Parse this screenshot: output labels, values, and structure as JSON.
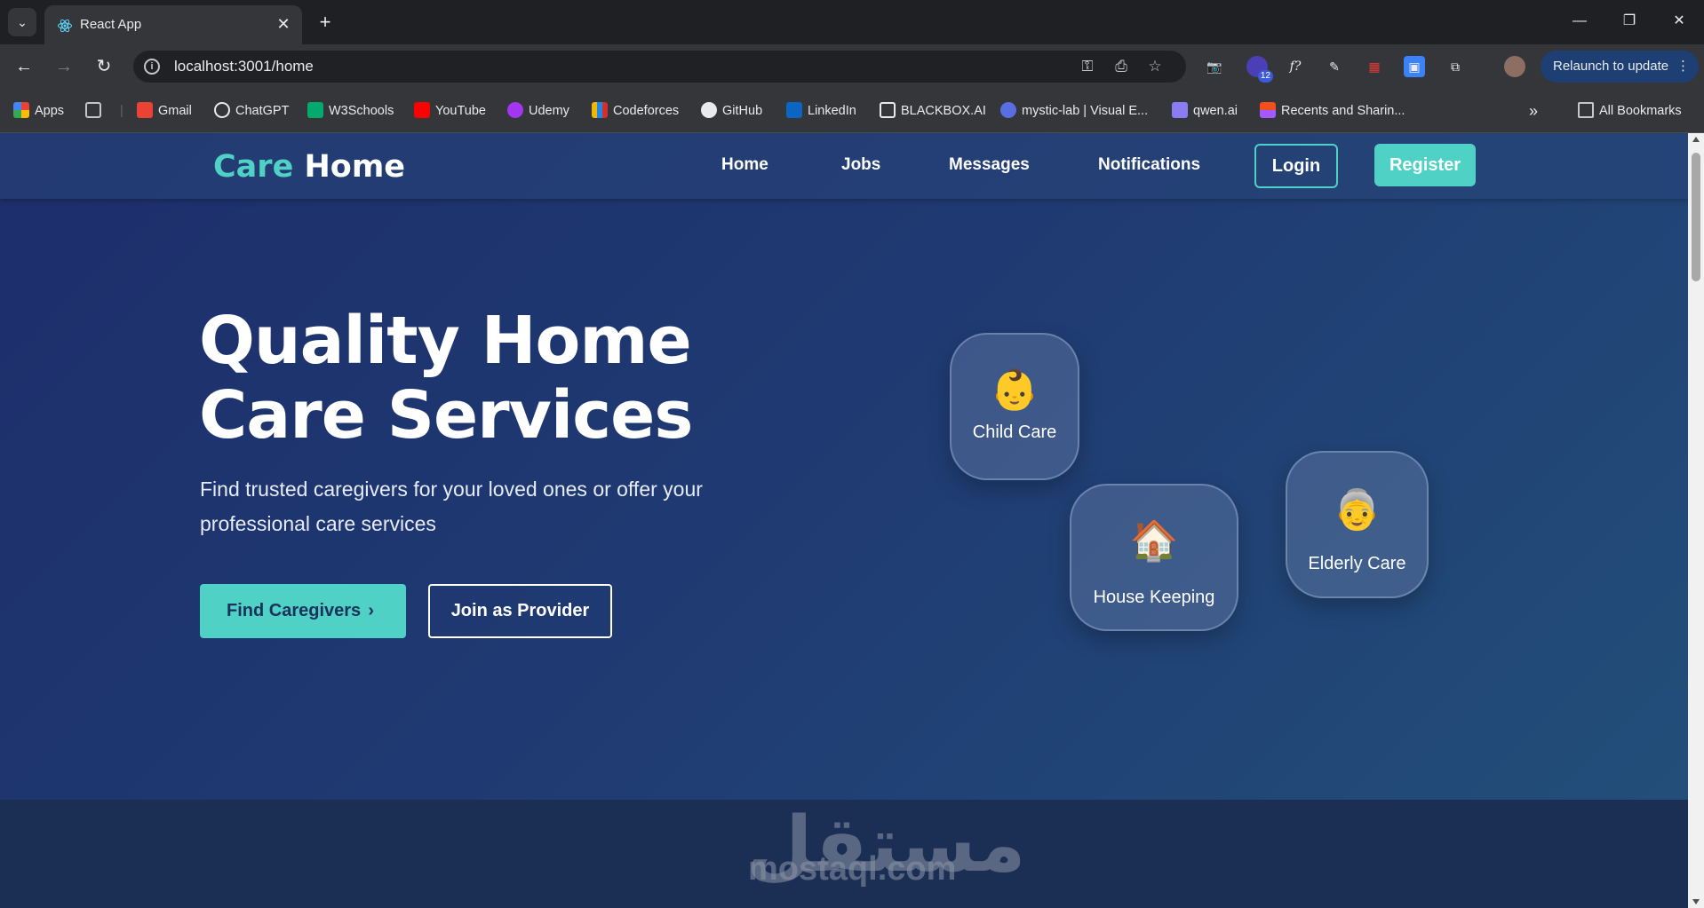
{
  "browser": {
    "tab_title": "React App",
    "url": "localhost:3001/home",
    "relaunch_label": "Relaunch to update",
    "extension_badge": "12",
    "bookmarks": [
      {
        "label": "Apps",
        "icon": "apps-grid-icon",
        "color": "#ea4335"
      },
      {
        "label": "Gmail",
        "icon": "gmail-icon",
        "color": "#ea4335"
      },
      {
        "label": "ChatGPT",
        "icon": "chatgpt-icon",
        "color": "#e8eaed"
      },
      {
        "label": "W3Schools",
        "icon": "w3schools-icon",
        "color": "#04aa6d"
      },
      {
        "label": "YouTube",
        "icon": "youtube-icon",
        "color": "#ff0000"
      },
      {
        "label": "Udemy",
        "icon": "udemy-icon",
        "color": "#a435f0"
      },
      {
        "label": "Codeforces",
        "icon": "codeforces-icon",
        "color": "#f2b705"
      },
      {
        "label": "GitHub",
        "icon": "github-icon",
        "color": "#e8eaed"
      },
      {
        "label": "LinkedIn",
        "icon": "linkedin-icon",
        "color": "#0a66c2"
      },
      {
        "label": "BLACKBOX.AI",
        "icon": "blackbox-icon",
        "color": "#e8eaed"
      },
      {
        "label": "mystic-lab | Visual E...",
        "icon": "mystic-lab-icon",
        "color": "#5b6ee1"
      },
      {
        "label": "qwen.ai",
        "icon": "qwen-icon",
        "color": "#8b7cf6"
      },
      {
        "label": "Recents and Sharin...",
        "icon": "figma-icon",
        "color": "#f24e1e"
      }
    ],
    "all_bookmarks_label": "All Bookmarks"
  },
  "site": {
    "logo_part1": "Care",
    "logo_part2": "Home",
    "nav": [
      "Home",
      "Jobs",
      "Messages",
      "Notifications"
    ],
    "login_label": "Login",
    "register_label": "Register"
  },
  "hero": {
    "title": "Quality Home Care Services",
    "subtitle": "Find trusted caregivers for your loved ones or offer your professional care services",
    "find_button": "Find Caregivers",
    "join_button": "Join as Provider"
  },
  "services": [
    {
      "label": "Child Care",
      "emoji": "👶"
    },
    {
      "label": "House Keeping",
      "emoji": "🏠"
    },
    {
      "label": "Elderly Care",
      "emoji": "👵"
    }
  ],
  "watermark": {
    "arabic": "مستقل",
    "latin": "mostaql.com"
  },
  "colors": {
    "accent": "#4fd1c5",
    "hero_bg_start": "#1d2e6c",
    "hero_bg_end": "#23507a"
  }
}
